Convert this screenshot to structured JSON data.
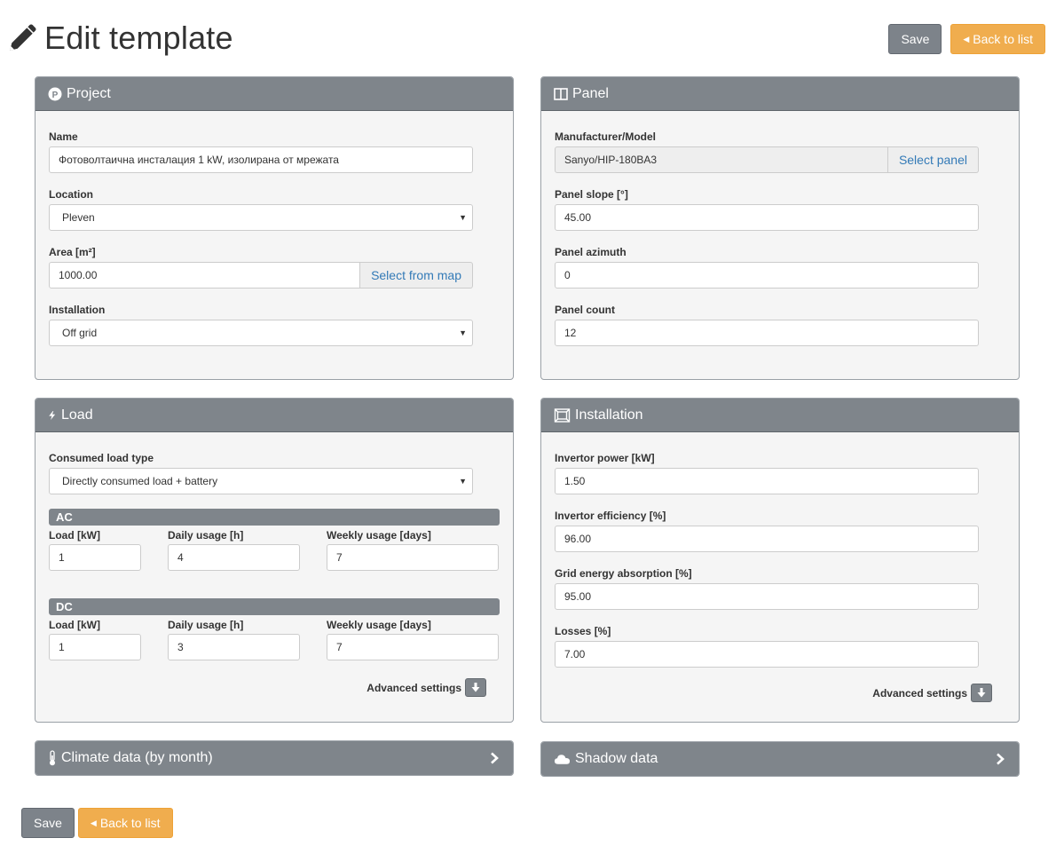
{
  "page": {
    "title": "Edit template",
    "save_label": "Save",
    "back_label": "Back to list"
  },
  "project": {
    "heading": "Project",
    "name_label": "Name",
    "name_value": "Фотоволтаична инсталация 1 kW, изолирана от мрежата",
    "location_label": "Location",
    "location_value": "Pleven",
    "area_label": "Area [m²]",
    "area_value": "1000.00",
    "select_map_label": "Select from map",
    "installation_label": "Installation",
    "installation_value": "Off grid"
  },
  "panel": {
    "heading": "Panel",
    "manufacturer_label": "Manufacturer/Model",
    "manufacturer_value": "Sanyo/HIP-180BA3",
    "select_panel_label": "Select panel",
    "slope_label": "Panel slope [°]",
    "slope_value": "45.00",
    "azimuth_label": "Panel azimuth",
    "azimuth_value": "0",
    "count_label": "Panel count",
    "count_value": "12"
  },
  "load": {
    "heading": "Load",
    "type_label": "Consumed load type",
    "type_value": "Directly consumed load + battery",
    "ac": {
      "title": "AC",
      "load_label": "Load [kW]",
      "load_value": "1",
      "daily_label": "Daily usage [h]",
      "daily_value": "4",
      "weekly_label": "Weekly usage [days]",
      "weekly_value": "7"
    },
    "dc": {
      "title": "DC",
      "load_label": "Load [kW]",
      "load_value": "1",
      "daily_label": "Daily usage [h]",
      "daily_value": "3",
      "weekly_label": "Weekly usage [days]",
      "weekly_value": "7"
    },
    "advanced_label": "Advanced settings"
  },
  "installation": {
    "heading": "Installation",
    "invertor_power_label": "Invertor power [kW]",
    "invertor_power_value": "1.50",
    "invertor_eff_label": "Invertor efficiency [%]",
    "invertor_eff_value": "96.00",
    "grid_label": "Grid energy absorption [%]",
    "grid_value": "95.00",
    "losses_label": "Losses [%]",
    "losses_value": "7.00",
    "advanced_label": "Advanced settings"
  },
  "climate": {
    "heading": "Climate data (by month)"
  },
  "shadow": {
    "heading": "Shadow data"
  },
  "icons": {
    "title": "pencil-icon",
    "project": "project-p-icon",
    "panel": "columns-icon",
    "load": "bolt-icon",
    "installation": "installation-icon",
    "climate": "thermometer-icon",
    "shadow": "cloud-icon",
    "advanced": "arrow-down-icon",
    "expand": "chevron-right-icon"
  },
  "colors": {
    "header_bg": "#7f858b",
    "save_bg": "#7d838a",
    "back_bg": "#f0ad4e",
    "link": "#337ab7",
    "panel_bg": "#f5f5f5"
  }
}
